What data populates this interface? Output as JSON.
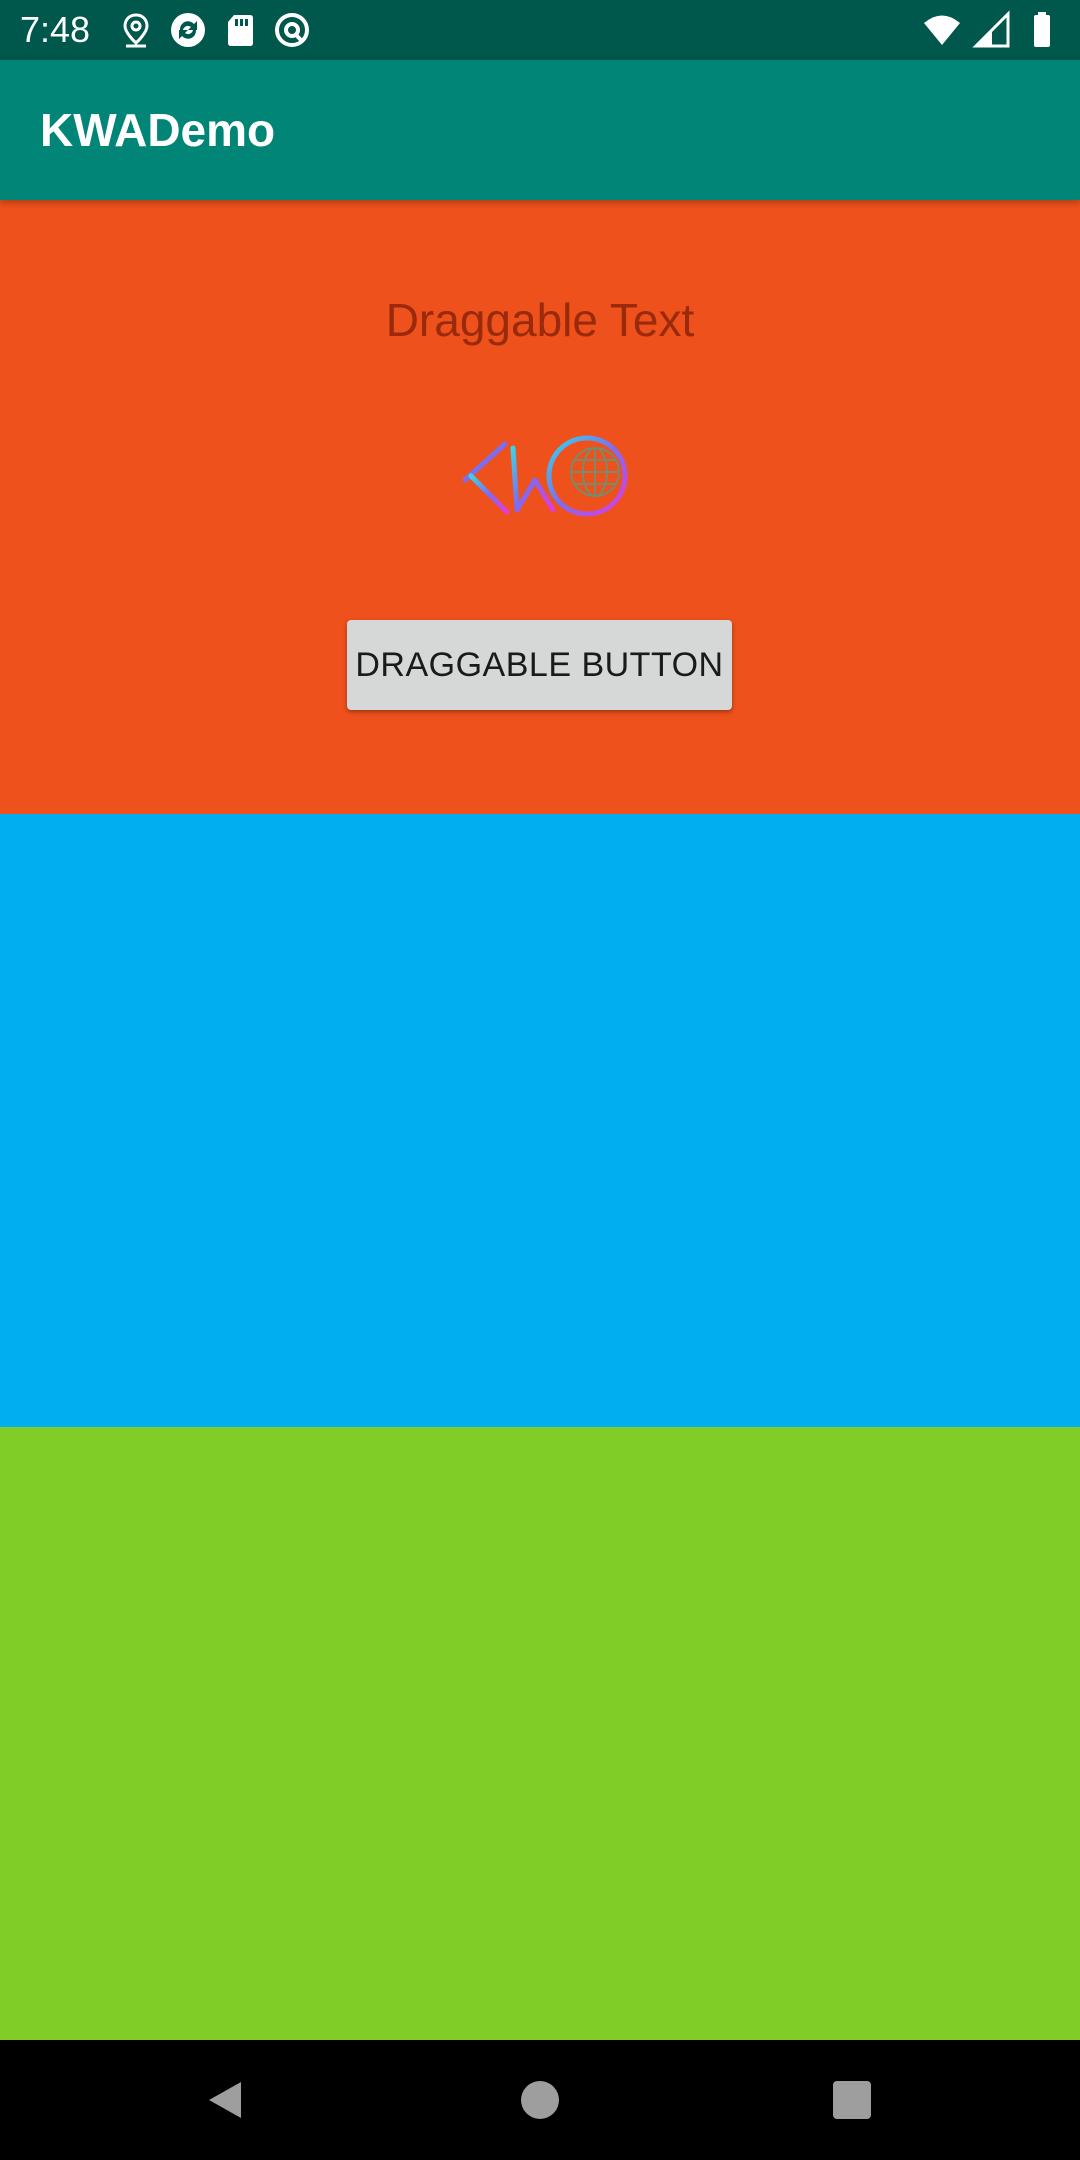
{
  "status_bar": {
    "time": "7:48",
    "left_icons": [
      "location-pin-icon",
      "sync-icon",
      "sd-card-icon",
      "do-not-disturb-icon"
    ],
    "right_icons": [
      "wifi-icon",
      "cell-signal-icon",
      "battery-icon"
    ],
    "background": "#00574B"
  },
  "app_bar": {
    "title": "KWADemo",
    "background": "#008577"
  },
  "panels": {
    "top": {
      "color": "#EE511C",
      "text": "Draggable Text",
      "logo": "kw-logo",
      "button_label": "DRAGGABLE BUTTON"
    },
    "middle": {
      "color": "#01AEEF"
    },
    "bottom": {
      "color": "#81CD28"
    }
  },
  "nav_bar": {
    "icons": [
      "back-icon",
      "home-icon",
      "recents-icon"
    ]
  }
}
